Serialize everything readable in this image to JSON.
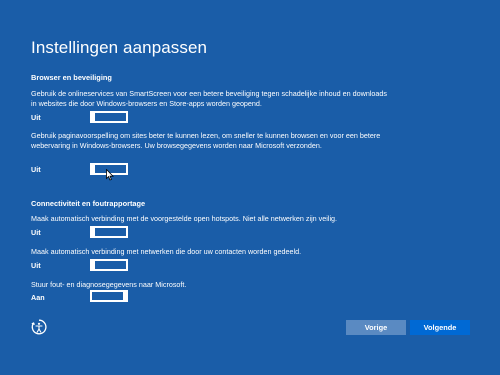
{
  "page": {
    "title": "Instellingen aanpassen"
  },
  "sections": [
    {
      "heading": "Browser en beveiliging",
      "settings": [
        {
          "description": "Gebruik de onlineservices van SmartScreen voor een betere beveiliging tegen schadelijke inhoud en downloads in websites die door Windows-browsers en Store-apps worden geopend.",
          "state_label": "Uit",
          "on": false
        },
        {
          "description": "Gebruik paginavoorspelling om sites beter te kunnen lezen, om sneller te kunnen browsen en voor een betere webervaring in Windows-browsers. Uw browsegegevens worden naar Microsoft verzonden.",
          "state_label": "Uit",
          "on": false
        }
      ]
    },
    {
      "heading": "Connectiviteit en foutrapportage",
      "settings": [
        {
          "description": "Maak automatisch verbinding met de voorgestelde open hotspots. Niet alle netwerken zijn veilig.",
          "state_label": "Uit",
          "on": false
        },
        {
          "description": "Maak automatisch verbinding met netwerken die door uw contacten worden gedeeld.",
          "state_label": "Uit",
          "on": false
        },
        {
          "description": "Stuur fout- en diagnosegegevens naar Microsoft.",
          "state_label": "Aan",
          "on": true
        }
      ]
    }
  ],
  "buttons": {
    "back_label": "Vorige",
    "next_label": "Volgende"
  },
  "icons": {
    "accessibility": "ease-of-access-icon",
    "cursor": "mouse-pointer-icon"
  },
  "colors": {
    "background": "#1a5da8",
    "back_button": "#5a8ac2",
    "next_button": "#0069d4",
    "text": "#ffffff"
  }
}
